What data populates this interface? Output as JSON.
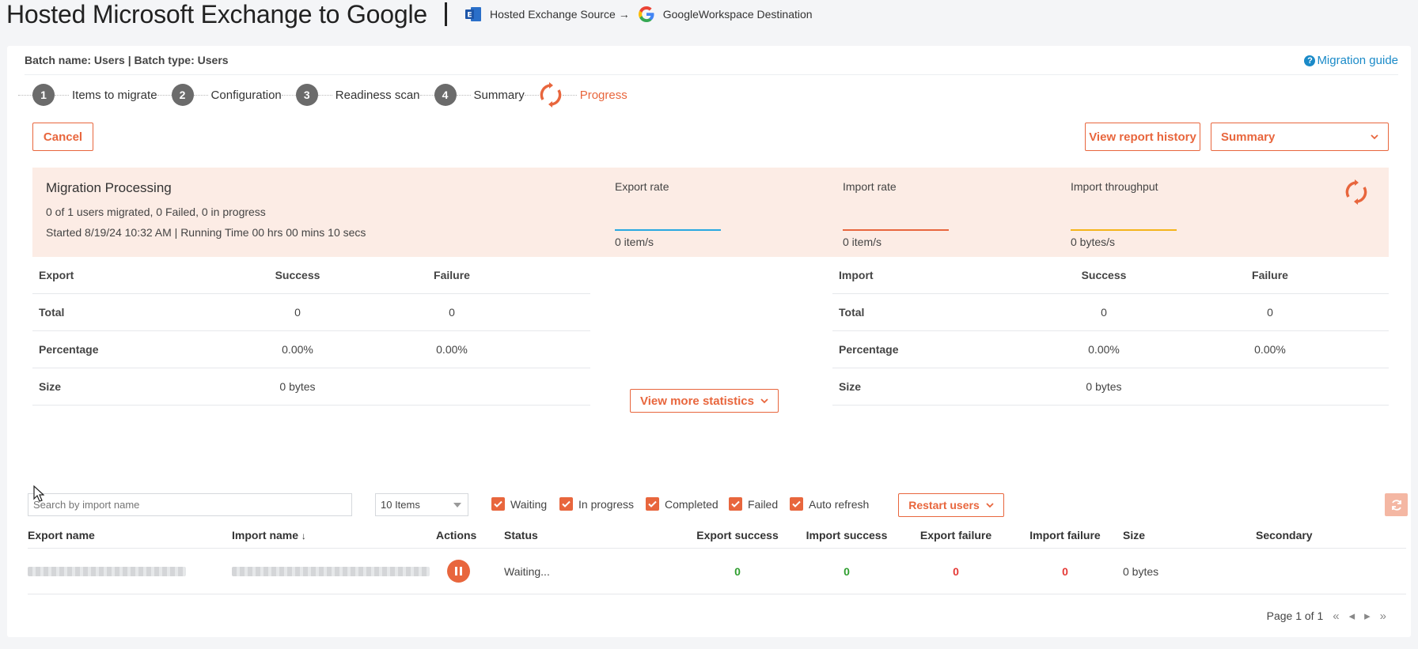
{
  "header": {
    "title": "Hosted Microsoft Exchange to Google",
    "source_label": "Hosted Exchange Source",
    "arrow": "→",
    "destination_label": "GoogleWorkspace Destination"
  },
  "batch": {
    "info": "Batch name: Users | Batch type: Users",
    "guide_label": "Migration guide"
  },
  "steps": [
    {
      "num": "1",
      "label": "Items to migrate"
    },
    {
      "num": "2",
      "label": "Configuration"
    },
    {
      "num": "3",
      "label": "Readiness scan"
    },
    {
      "num": "4",
      "label": "Summary"
    },
    {
      "num": "",
      "label": "Progress"
    }
  ],
  "actions": {
    "cancel": "Cancel",
    "report_history": "View report history",
    "summary_select": "Summary"
  },
  "processing": {
    "title": "Migration Processing",
    "status": "0 of 1 users migrated, 0 Failed, 0 in progress",
    "started": "Started 8/19/24 10:32 AM | Running Time 00 hrs 00 mins 10 secs",
    "rates": [
      {
        "label": "Export rate",
        "value": "0 item/s",
        "color": "#29a8e0"
      },
      {
        "label": "Import rate",
        "value": "0 item/s",
        "color": "#e8663d"
      },
      {
        "label": "Import throughput",
        "value": "0 bytes/s",
        "color": "#f4b41a"
      }
    ]
  },
  "export_stats": {
    "headers": [
      "Export",
      "Success",
      "Failure"
    ],
    "rows": [
      [
        "Total",
        "0",
        "0"
      ],
      [
        "Percentage",
        "0.00%",
        "0.00%"
      ],
      [
        "Size",
        "0 bytes",
        ""
      ]
    ]
  },
  "import_stats": {
    "headers": [
      "Import",
      "Success",
      "Failure"
    ],
    "rows": [
      [
        "Total",
        "0",
        "0"
      ],
      [
        "Percentage",
        "0.00%",
        "0.00%"
      ],
      [
        "Size",
        "0 bytes",
        ""
      ]
    ]
  },
  "more_stats": "View more statistics",
  "filters": {
    "search_placeholder": "Search by import name",
    "items_per_page": "10 Items",
    "checks": [
      "Waiting",
      "In progress",
      "Completed",
      "Failed",
      "Auto refresh"
    ],
    "restart": "Restart users"
  },
  "table": {
    "columns": [
      "Export name",
      "Import name",
      "Actions",
      "Status",
      "Export success",
      "Import success",
      "Export failure",
      "Import failure",
      "Size",
      "Secondary"
    ],
    "rows": [
      {
        "status": "Waiting...",
        "export_success": "0",
        "import_success": "0",
        "export_failure": "0",
        "import_failure": "0",
        "size": "0 bytes",
        "secondary": ""
      }
    ]
  },
  "pager": {
    "label": "Page 1 of 1"
  },
  "colors": {
    "accent": "#e8663d",
    "link": "#1a8ac8",
    "success": "#2f9e2f",
    "failure": "#e53935"
  }
}
